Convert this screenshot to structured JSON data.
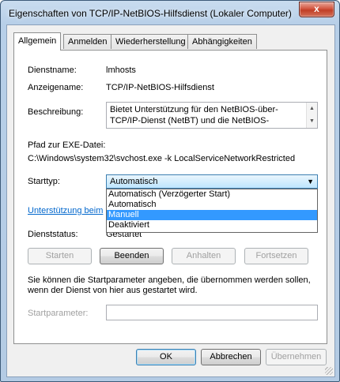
{
  "window": {
    "title": "Eigenschaften von TCP/IP-NetBIOS-Hilfsdienst (Lokaler Computer)",
    "close_label": "x"
  },
  "tabs": [
    {
      "label": "Allgemein",
      "active": true
    },
    {
      "label": "Anmelden",
      "active": false
    },
    {
      "label": "Wiederherstellung",
      "active": false
    },
    {
      "label": "Abhängigkeiten",
      "active": false
    }
  ],
  "general": {
    "service_name_label": "Dienstname:",
    "service_name_value": "lmhosts",
    "display_name_label": "Anzeigename:",
    "display_name_value": "TCP/IP-NetBIOS-Hilfsdienst",
    "description_label": "Beschreibung:",
    "description_line1": "Bietet Unterstützung für den NetBIOS-über-",
    "description_line2": "TCP/IP-Dienst (NetBT) und die NetBIOS-",
    "exe_path_label": "Pfad zur EXE-Datei:",
    "exe_path_value": "C:\\Windows\\system32\\svchost.exe -k LocalServiceNetworkRestricted",
    "startup_type_label": "Starttyp:",
    "startup_type_selected": "Automatisch",
    "startup_type_options": [
      {
        "label": "Automatisch (Verzögerter Start)",
        "selected": false
      },
      {
        "label": "Automatisch",
        "selected": false
      },
      {
        "label": "Manuell",
        "selected": true
      },
      {
        "label": "Deaktiviert",
        "selected": false
      }
    ],
    "help_link": "Unterstützung beim",
    "status_label": "Dienststatus:",
    "status_value": "Gestartet",
    "start_button": "Starten",
    "stop_button": "Beenden",
    "pause_button": "Anhalten",
    "resume_button": "Fortsetzen",
    "hint_line1": "Sie können die Startparameter angeben, die übernommen werden sollen,",
    "hint_line2": "wenn der Dienst von hier aus gestartet wird.",
    "start_params_label": "Startparameter:",
    "start_params_value": ""
  },
  "footer": {
    "ok_button": "OK",
    "cancel_button": "Abbrechen",
    "apply_button": "Übernehmen"
  }
}
